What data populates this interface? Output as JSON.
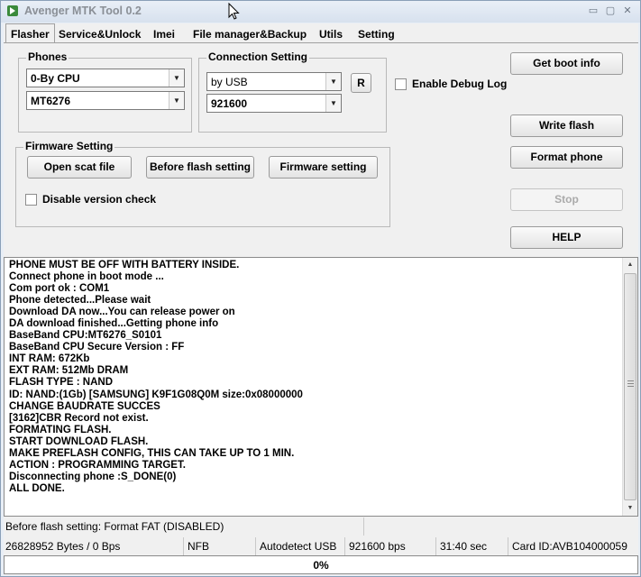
{
  "window": {
    "title": "Avenger MTK Tool 0.2",
    "min_glyph": "▭",
    "max_glyph": "▢",
    "close_glyph": "✕"
  },
  "tabs": [
    {
      "label": "Flasher",
      "active": true
    },
    {
      "label": "Service&Unlock"
    },
    {
      "label": "Imei"
    },
    {
      "label": "File manager&Backup"
    },
    {
      "label": "Utils"
    },
    {
      "label": "Setting"
    }
  ],
  "phones": {
    "legend": "Phones",
    "cpu_select": "0-By CPU",
    "model_select": "MT6276"
  },
  "connection": {
    "legend": "Connection Setting",
    "port_select": "by USB",
    "baud_select": "921600",
    "refresh_label": "R"
  },
  "debug_log": {
    "label": "Enable Debug Log",
    "checked": false
  },
  "firmware": {
    "legend": "Firmware Setting",
    "open_scat_label": "Open scat file",
    "before_flash_label": "Before flash setting",
    "firmware_setting_label": "Firmware setting",
    "disable_version_label": "Disable version check"
  },
  "actions": {
    "get_boot_info": "Get boot info",
    "write_flash": "Write flash",
    "format_phone": "Format phone",
    "stop": "Stop",
    "help": "HELP"
  },
  "log": [
    "PHONE MUST BE OFF WITH BATTERY INSIDE.",
    "Connect phone in boot mode ...",
    "Com port ok : COM1",
    "Phone detected...Please wait",
    "Download DA now...You can release power on",
    "DA download finished...Getting phone info",
    "BaseBand CPU:MT6276_S0101",
    "BaseBand CPU Secure Version : FF",
    "INT RAM: 672Kb",
    "EXT RAM: 512Mb DRAM",
    "FLASH TYPE : NAND",
    "ID: NAND:(1Gb) [SAMSUNG] K9F1G08Q0M  size:0x08000000",
    "CHANGE BAUDRATE SUCCES",
    "[3162]CBR Record not exist.",
    "FORMATING FLASH.",
    "START DOWNLOAD FLASH.",
    "MAKE PREFLASH CONFIG, THIS CAN TAKE UP TO 1 MIN.",
    "ACTION : PROGRAMMING TARGET.",
    "Disconnecting phone :S_DONE(0)",
    "ALL DONE."
  ],
  "status1": {
    "message": "Before flash setting: Format FAT (DISABLED)"
  },
  "status2": {
    "bytes": "26828952 Bytes / 0 Bps",
    "nfb": "NFB",
    "detect": "Autodetect USB",
    "baud": "921600 bps",
    "time": "31:40 sec",
    "card": "Card ID:AVB104000059"
  },
  "progress": {
    "value": 0,
    "label": "0%"
  },
  "colors": {
    "progress_fill": "#3a9d3a",
    "app_icon": "#3b8a3b"
  }
}
